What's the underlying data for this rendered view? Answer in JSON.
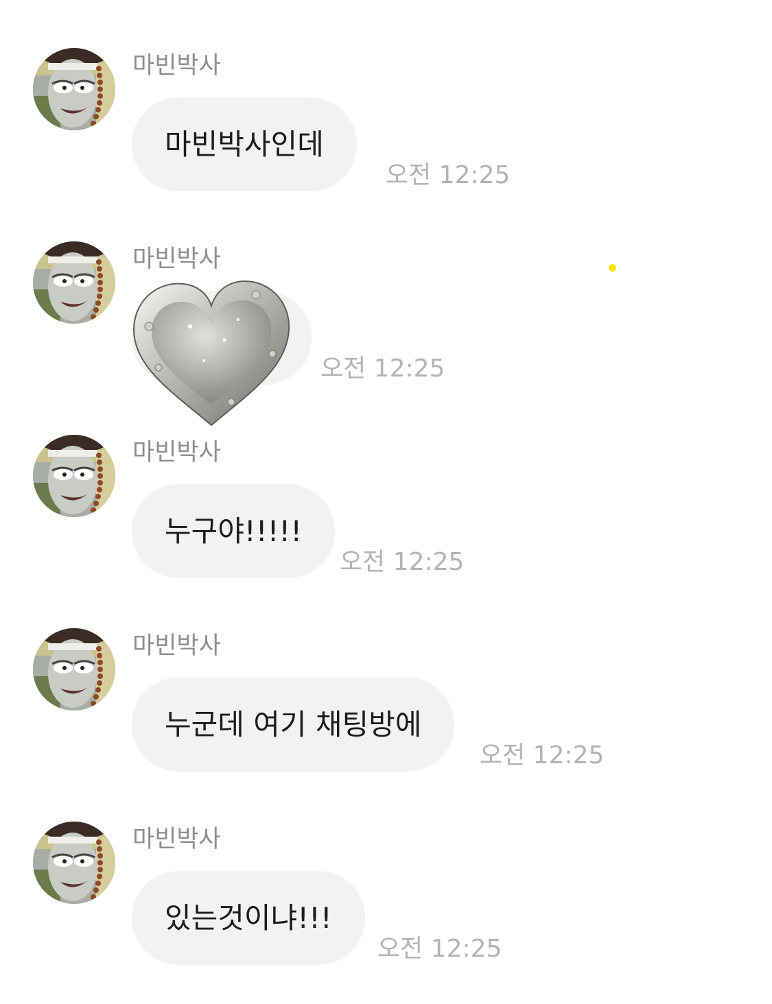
{
  "messages": [
    {
      "sender": "마빈박사",
      "text": "마빈박사인데",
      "time": "오전 12:25"
    },
    {
      "sender": "마빈박사",
      "sticker": "crystal-heart-sticker",
      "time": "오전 12:25"
    },
    {
      "sender": "마빈박사",
      "text": "누구야!!!!!",
      "time": "오전 12:25"
    },
    {
      "sender": "마빈박사",
      "text": "누군데 여기 채팅방에",
      "time": "오전 12:25"
    },
    {
      "sender": "마빈박사",
      "text": "있는것이냐!!!",
      "time": "오전 12:25"
    }
  ],
  "colors": {
    "bubble": "#f2f2f4",
    "sender": "#8e8e93",
    "time": "#b3b3b8",
    "text": "#1c1c1e",
    "dot": "#f5e500"
  }
}
